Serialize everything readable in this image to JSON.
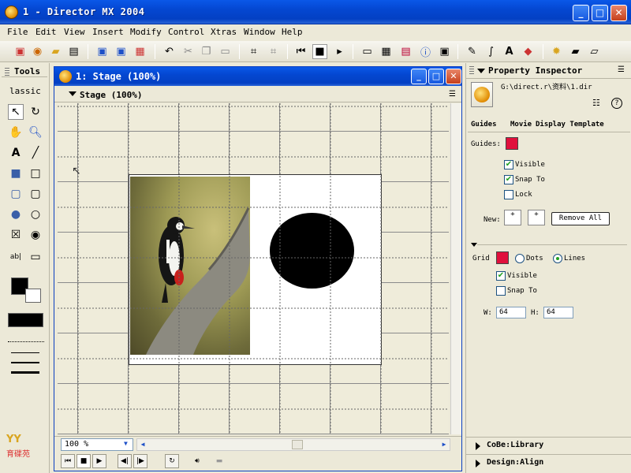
{
  "app": {
    "title": "1 - Director MX 2004",
    "buttons": {
      "minimize": "_",
      "maximize": "□",
      "close": "✕"
    }
  },
  "menus": [
    "File",
    "Edit",
    "View",
    "Insert",
    "Modify",
    "Control",
    "Xtras",
    "Window",
    "Help"
  ],
  "toolbar_icons": [
    "new-icon",
    "open-icon",
    "open-folder-icon",
    "import-icon",
    "save-icon",
    "save-all-icon",
    "publish-icon",
    "undo-icon",
    "cut-icon",
    "copy-icon",
    "paste-icon",
    "find-icon",
    "exchange-icon",
    "rewind-icon",
    "stop-icon",
    "play-icon",
    "stage-window-icon",
    "cast-window-icon",
    "score-window-icon",
    "property-icon",
    "library-icon",
    "paint-icon",
    "vector-icon",
    "text-icon",
    "script-icon",
    "behavior-icon",
    "message-icon",
    "library-palette-icon"
  ],
  "tools": {
    "title": "Tools",
    "mode": "lassic",
    "items": [
      "arrow-icon",
      "rotate-icon",
      "hand-icon",
      "magnifier-icon",
      "text-tool-icon",
      "line-tool-icon",
      "filled-rect-icon",
      "rect-icon",
      "filled-roundrect-icon",
      "roundrect-icon",
      "filled-ellipse-icon",
      "ellipse-icon",
      "checkbox-tool-icon",
      "radio-tool-icon",
      "field-tool-icon",
      "button-tool-icon"
    ]
  },
  "stage": {
    "title": "1: Stage (100%)",
    "subtitle": "Stage (100%)",
    "zoom": "100 %"
  },
  "property_inspector": {
    "title": "Property Inspector",
    "path": "G:\\direct.r\\资料\\1.dir",
    "tabs": [
      "Guides",
      "Movie",
      "Display Template"
    ],
    "guides": {
      "label": "Guides:",
      "color": "#e0103c",
      "visible_label": "Visible",
      "visible": true,
      "snap_label": "Snap To",
      "snap": true,
      "lock_label": "Lock",
      "lock": false,
      "new_label": "New:",
      "remove_all": "Remove All"
    },
    "grid": {
      "label": "Grid",
      "color": "#e0103c",
      "dots_label": "Dots",
      "lines_label": "Lines",
      "lines_selected": true,
      "visible_label": "Visible",
      "visible": true,
      "snap_label": "Snap To",
      "snap": false,
      "w_label": "W:",
      "w_value": "64",
      "h_label": "H:",
      "h_value": "64"
    },
    "panels": [
      "CoBe:Library",
      "Design:Align"
    ]
  },
  "logo_text": "育碟苑"
}
